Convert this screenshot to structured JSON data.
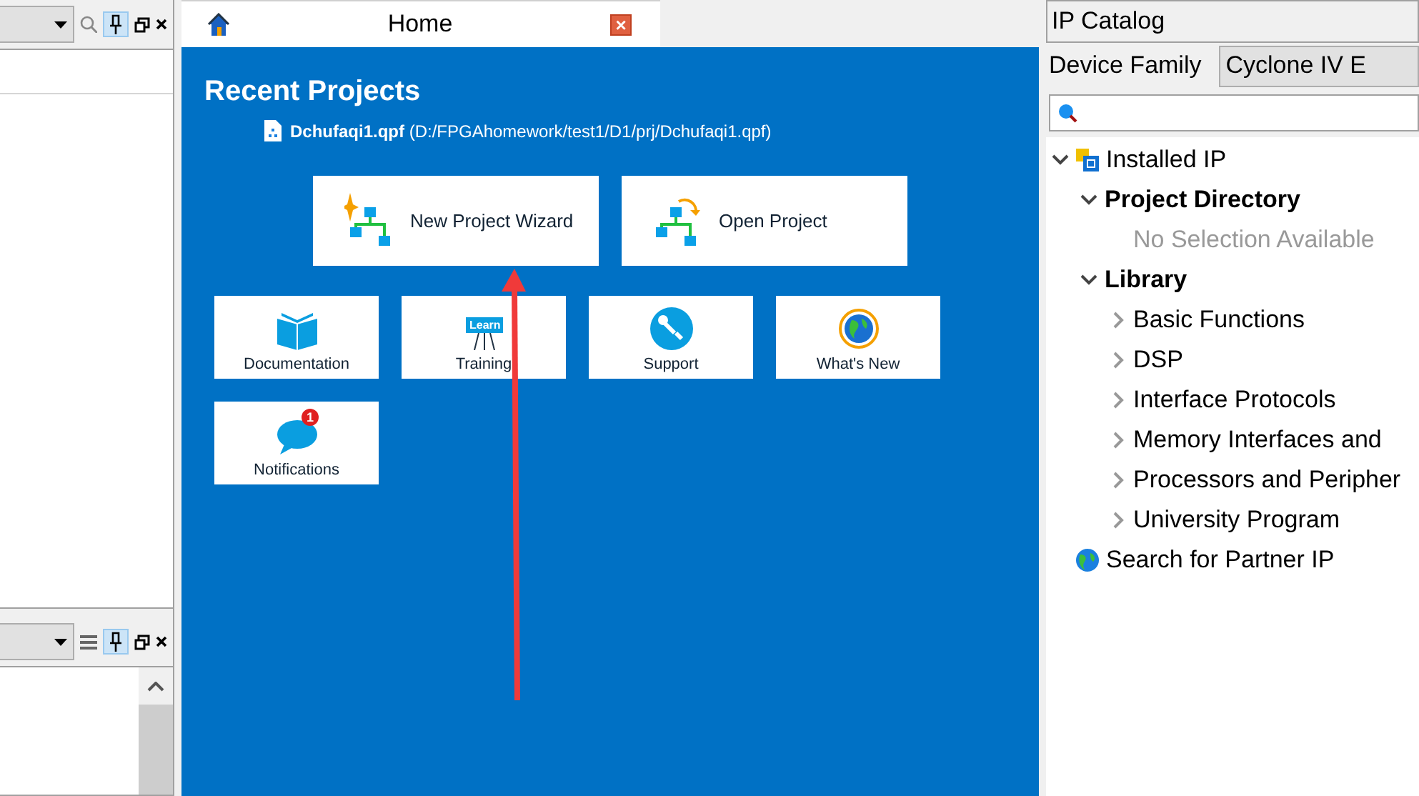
{
  "home_tab": {
    "title": "Home",
    "close": "×"
  },
  "recent_projects": {
    "heading": "Recent Projects",
    "items": [
      "**Dchufaqi1.qpf** (D:/FPGAhomework/test1/D1/prj/Dchufaqi1.qpf)"
    ]
  },
  "actions": [
    {
      "kind": "wizard",
      "label": "New Project Wizard"
    },
    {
      "kind": "open",
      "label": "Open Project"
    }
  ],
  "tiles": [
    {
      "kind": "book",
      "label": "Documentation"
    },
    {
      "kind": "learn",
      "label": "Training",
      "icon_text": "Learn"
    },
    {
      "kind": "support",
      "label": "Support"
    },
    {
      "kind": "globe",
      "label": "What's New"
    },
    {
      "kind": "chat",
      "label": "Notifications",
      "badge": "1"
    }
  ],
  "ip_catalog": {
    "title": "IP Catalog",
    "device_family_label": "Device Family",
    "device_family": "Cyclone IV E",
    "tree": [
      {
        "kind": "chip",
        "label": "Installed IP",
        "expanded": true,
        "children": [
          {
            "kind": "group",
            "label": "Project Directory",
            "expanded": true,
            "children": [
              {
                "kind": "empty",
                "label": "No Selection Available"
              }
            ]
          },
          {
            "kind": "group",
            "label": "Library",
            "expanded": true,
            "children": [
              {
                "kind": "item",
                "label": "Basic Functions",
                "expanded": false
              },
              {
                "kind": "item",
                "label": "DSP",
                "expanded": false
              },
              {
                "kind": "item",
                "label": "Interface Protocols",
                "expanded": false
              },
              {
                "kind": "item",
                "label": "Memory Interfaces and",
                "expanded": false
              },
              {
                "kind": "item",
                "label": "Processors and Peripher",
                "expanded": false
              },
              {
                "kind": "item",
                "label": "University Program",
                "expanded": false
              }
            ]
          }
        ]
      },
      {
        "kind": "globe",
        "label": "Search for Partner IP"
      }
    ]
  },
  "left_panels": [
    {
      "kind": "search",
      "pin_selected": true
    },
    {
      "kind": "menu",
      "pin_selected": true
    }
  ]
}
